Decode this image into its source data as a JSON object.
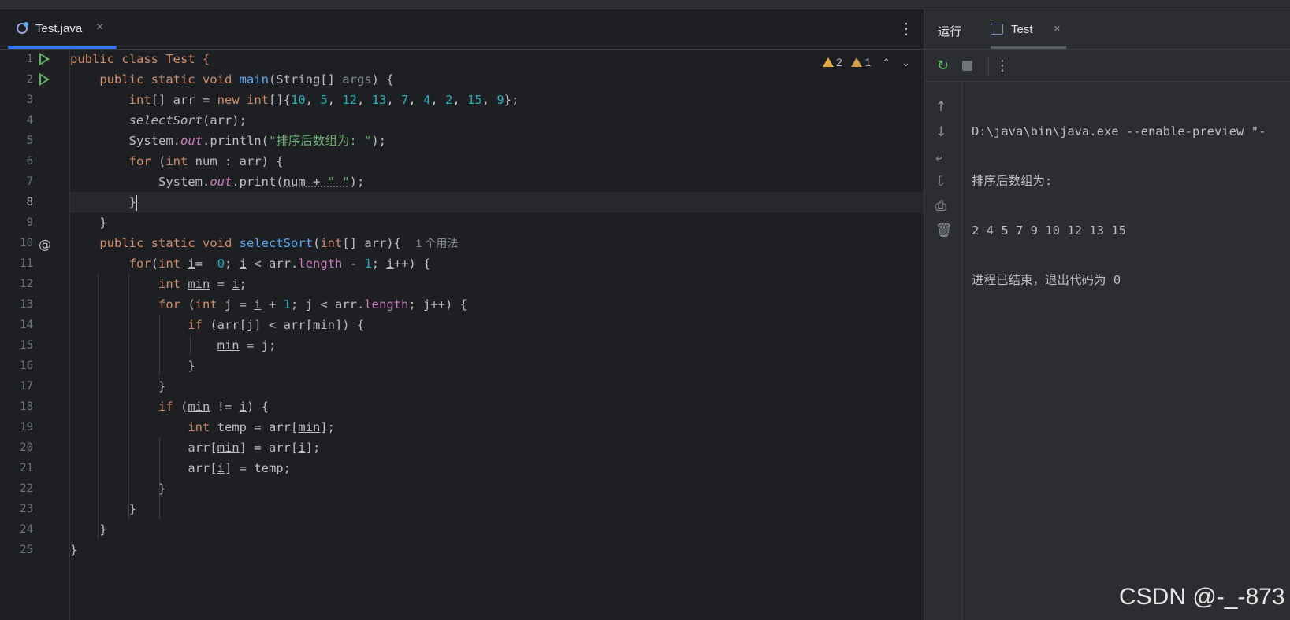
{
  "editor": {
    "tab": {
      "filename": "Test.java",
      "close": "×"
    },
    "menu": "⋮",
    "inspections": {
      "warnings": "2",
      "weak": "1",
      "up": "⌃",
      "down": "⌄"
    },
    "lines": [
      "1",
      "2",
      "3",
      "4",
      "5",
      "6",
      "7",
      "8",
      "9",
      "10",
      "11",
      "12",
      "13",
      "14",
      "15",
      "16",
      "17",
      "18",
      "19",
      "20",
      "21",
      "22",
      "23",
      "24",
      "25"
    ],
    "at_gutter": "@",
    "code": {
      "l1": {
        "a": "public class Test {"
      },
      "l2": {
        "kw": "public static void ",
        "fn": "main",
        "rest": "(String[] ",
        "arg": "args",
        "end": ") {"
      },
      "l3": {
        "kw1": "int",
        "a": "[] arr = ",
        "kw2": "new ",
        "kw3": "int",
        "b": "[]{",
        "n1": "10",
        "n2": "5",
        "n3": "12",
        "n4": "13",
        "n5": "7",
        "n6": "4",
        "n7": "2",
        "n8": "15",
        "n9": "9",
        "sep": ", ",
        "end": "};"
      },
      "l4": {
        "call": "selectSort",
        "rest": "(arr);"
      },
      "l5": {
        "a": "System.",
        "fld": "out",
        "b": ".println(",
        "str": "\"排序后数组为: \"",
        "end": ");"
      },
      "l6": {
        "kw1": "for ",
        "a": "(",
        "kw2": "int",
        "b": " num : arr) {"
      },
      "l7": {
        "a": "System.",
        "fld": "out",
        "b": ".print(",
        "c": "num + ",
        "str": "\" \"",
        "end": ");"
      },
      "l8": {
        "a": "}"
      },
      "l9": {
        "a": "}"
      },
      "l10": {
        "kw": "public static void ",
        "fn": "selectSort",
        "a": "(",
        "kw2": "int",
        "b": "[] arr){",
        "hint": "1 个用法"
      },
      "l11": {
        "kw": "for",
        "a": "(",
        "kw2": "int",
        "v": "i",
        "b": "=  ",
        "n0": "0",
        "c": "; ",
        "v2": "i",
        "d": " < arr.",
        "fld": "length",
        "e": " - ",
        "n1": "1",
        "f": "; ",
        "v3": "i",
        "g": "++) {"
      },
      "l12": {
        "kw": "int ",
        "v": "min",
        "a": " = ",
        "v2": "i",
        "b": ";"
      },
      "l13": {
        "kw": "for ",
        "a": "(",
        "kw2": "int ",
        "b": "j = ",
        "v": "i",
        "c": " + ",
        "n1": "1",
        "d": "; j < arr.",
        "fld": "length",
        "e": "; j++) {"
      },
      "l14": {
        "kw": "if ",
        "a": "(arr[j] < arr[",
        "v": "min",
        "b": "]) {"
      },
      "l15": {
        "v": "min",
        "a": " = j;"
      },
      "l16": {
        "a": "}"
      },
      "l17": {
        "a": "}"
      },
      "l18": {
        "kw": "if ",
        "a": "(",
        "v": "min",
        "b": " != ",
        "v2": "i",
        "c": ") {"
      },
      "l19": {
        "kw": "int ",
        "a": "temp = arr[",
        "v": "min",
        "b": "];"
      },
      "l20": {
        "a": "arr[",
        "v": "min",
        "b": "] = arr[",
        "v2": "i",
        "c": "];"
      },
      "l21": {
        "a": "arr[",
        "v": "i",
        "b": "] = temp;"
      },
      "l22": {
        "a": "}"
      },
      "l23": {
        "a": "}"
      },
      "l24": {
        "a": "}"
      },
      "l25": {
        "a": "}"
      }
    }
  },
  "run": {
    "title": "运行",
    "tab": {
      "name": "Test",
      "close": "×"
    },
    "toolbar": {
      "rerun": "↻",
      "more": "⋮"
    },
    "side": {
      "up": "↑",
      "down": "↓",
      "wrap": "⤶",
      "scroll": "⇩",
      "print": "⎙",
      "trash": "🗑"
    },
    "console": [
      "D:\\java\\bin\\java.exe --enable-preview \"-",
      "排序后数组为:",
      "2 4 5 7 9 10 12 13 15",
      "进程已结束，退出代码为 0"
    ]
  },
  "watermark": "CSDN @-_-873"
}
